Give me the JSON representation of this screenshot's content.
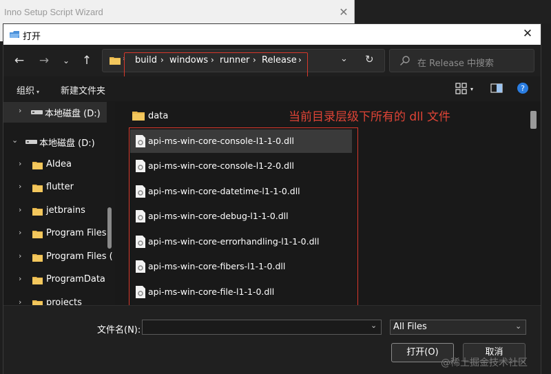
{
  "background_window": {
    "title": "Inno Setup Script Wizard"
  },
  "dialog": {
    "title": "打开",
    "breadcrumb": [
      "build",
      "windows",
      "runner",
      "Release"
    ],
    "search": {
      "placeholder": "在 Release 中搜索"
    },
    "toolbar": {
      "organize": "组织",
      "new_folder": "新建文件夹"
    },
    "sidebar": {
      "items": [
        {
          "label": "本地磁盘 (D:)",
          "icon": "drive-icon"
        },
        {
          "label": "本地磁盘 (D:)",
          "icon": "drive-icon"
        },
        {
          "label": "AIdea",
          "icon": "folder-icon"
        },
        {
          "label": "flutter",
          "icon": "folder-icon"
        },
        {
          "label": "jetbrains",
          "icon": "folder-icon"
        },
        {
          "label": "Program Files",
          "icon": "folder-icon"
        },
        {
          "label": "Program Files (",
          "icon": "folder-icon"
        },
        {
          "label": "ProgramData",
          "icon": "folder-icon"
        },
        {
          "label": "projects",
          "icon": "folder-icon"
        }
      ]
    },
    "files": {
      "folder": "data",
      "items": [
        "api-ms-win-core-console-l1-1-0.dll",
        "api-ms-win-core-console-l1-2-0.dll",
        "api-ms-win-core-datetime-l1-1-0.dll",
        "api-ms-win-core-debug-l1-1-0.dll",
        "api-ms-win-core-errorhandling-l1-1-0.dll",
        "api-ms-win-core-fibers-l1-1-0.dll",
        "api-ms-win-core-file-l1-1-0.dll"
      ],
      "annotation": "当前目录层级下所有的 dll 文件"
    },
    "bottom": {
      "filename_label": "文件名(N):",
      "filename_value": "",
      "filetype": "All Files",
      "open_button": "打开(O)",
      "cancel_button": "取消"
    }
  },
  "watermark": "@稀土掘金技术社区",
  "colors": {
    "annotation": "#e04436",
    "folder": "#e8b64a",
    "accent": "#2a7de1"
  }
}
